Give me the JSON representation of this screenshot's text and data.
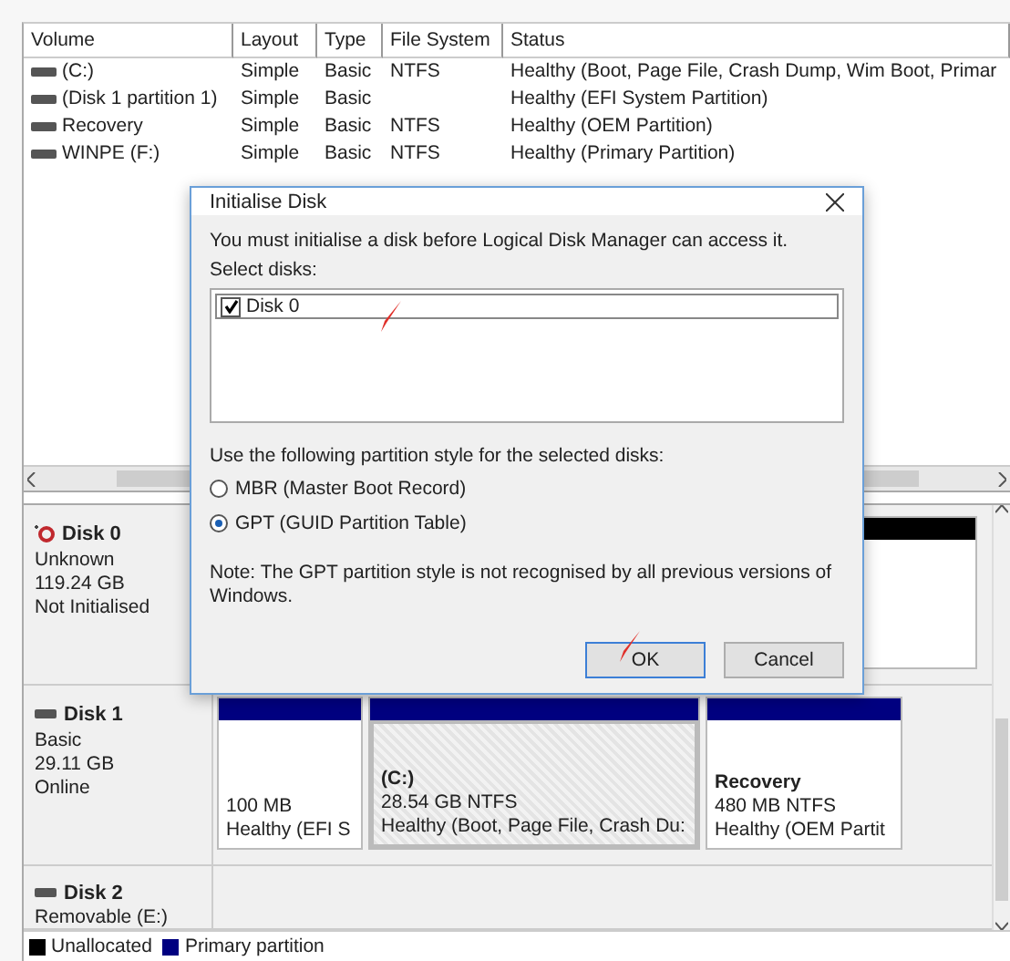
{
  "volume_table": {
    "columns": [
      "Volume",
      "Layout",
      "Type",
      "File System",
      "Status"
    ],
    "rows": [
      {
        "volume": "(C:)",
        "layout": "Simple",
        "type": "Basic",
        "file_system": "NTFS",
        "status": "Healthy (Boot, Page File, Crash Dump, Wim Boot, Primar"
      },
      {
        "volume": "(Disk 1 partition 1)",
        "layout": "Simple",
        "type": "Basic",
        "status": "Healthy (EFI System Partition)"
      },
      {
        "volume": "Recovery",
        "layout": "Simple",
        "type": "Basic",
        "file_system": "NTFS",
        "status": "Healthy (OEM Partition)"
      },
      {
        "volume": "WINPE (F:)",
        "layout": "Simple",
        "type": "Basic",
        "file_system": "NTFS",
        "status": "Healthy (Primary Partition)"
      }
    ]
  },
  "disks": [
    {
      "name": "Disk 0",
      "kind": "error",
      "info": [
        "Unknown",
        "119.24 GB",
        "Not Initialised"
      ],
      "partitions": [
        {
          "kind": "unallocated",
          "selected": false
        }
      ]
    },
    {
      "name": "Disk 1",
      "kind": "basic",
      "info": [
        "Basic",
        "29.11 GB",
        "Online"
      ],
      "partitions": [
        {
          "kind": "primary",
          "size": "100 MB",
          "status": "Healthy (EFI S",
          "selected": false
        },
        {
          "kind": "primary",
          "name": "(C:)",
          "size": "28.54 GB NTFS",
          "status": "Healthy (Boot, Page File, Crash Du:",
          "selected": true
        },
        {
          "kind": "primary",
          "name": "Recovery",
          "size": "480 MB NTFS",
          "status": "Healthy (OEM Partit",
          "selected": false
        }
      ]
    },
    {
      "name": "Disk 2",
      "kind": "basic",
      "info": [
        "Removable (E:)"
      ]
    }
  ],
  "legend": [
    {
      "label": "Unallocated",
      "color": "#000000"
    },
    {
      "label": "Primary partition",
      "color": "#000080"
    }
  ],
  "dialog": {
    "title": "Initialise Disk",
    "message": "You must initialise a disk before Logical Disk Manager can access it.",
    "select_label": "Select disks:",
    "disks": [
      {
        "label": "Disk 0",
        "checked": true
      }
    ],
    "style_label": "Use the following partition style for the selected disks:",
    "options": [
      {
        "label": "MBR (Master Boot Record)",
        "selected": false
      },
      {
        "label": "GPT (GUID Partition Table)",
        "selected": true
      }
    ],
    "note": "Note: The GPT partition style is not recognised by all previous versions of Windows.",
    "buttons": [
      {
        "label": "OK",
        "default": true
      },
      {
        "label": "Cancel",
        "default": false
      }
    ]
  }
}
